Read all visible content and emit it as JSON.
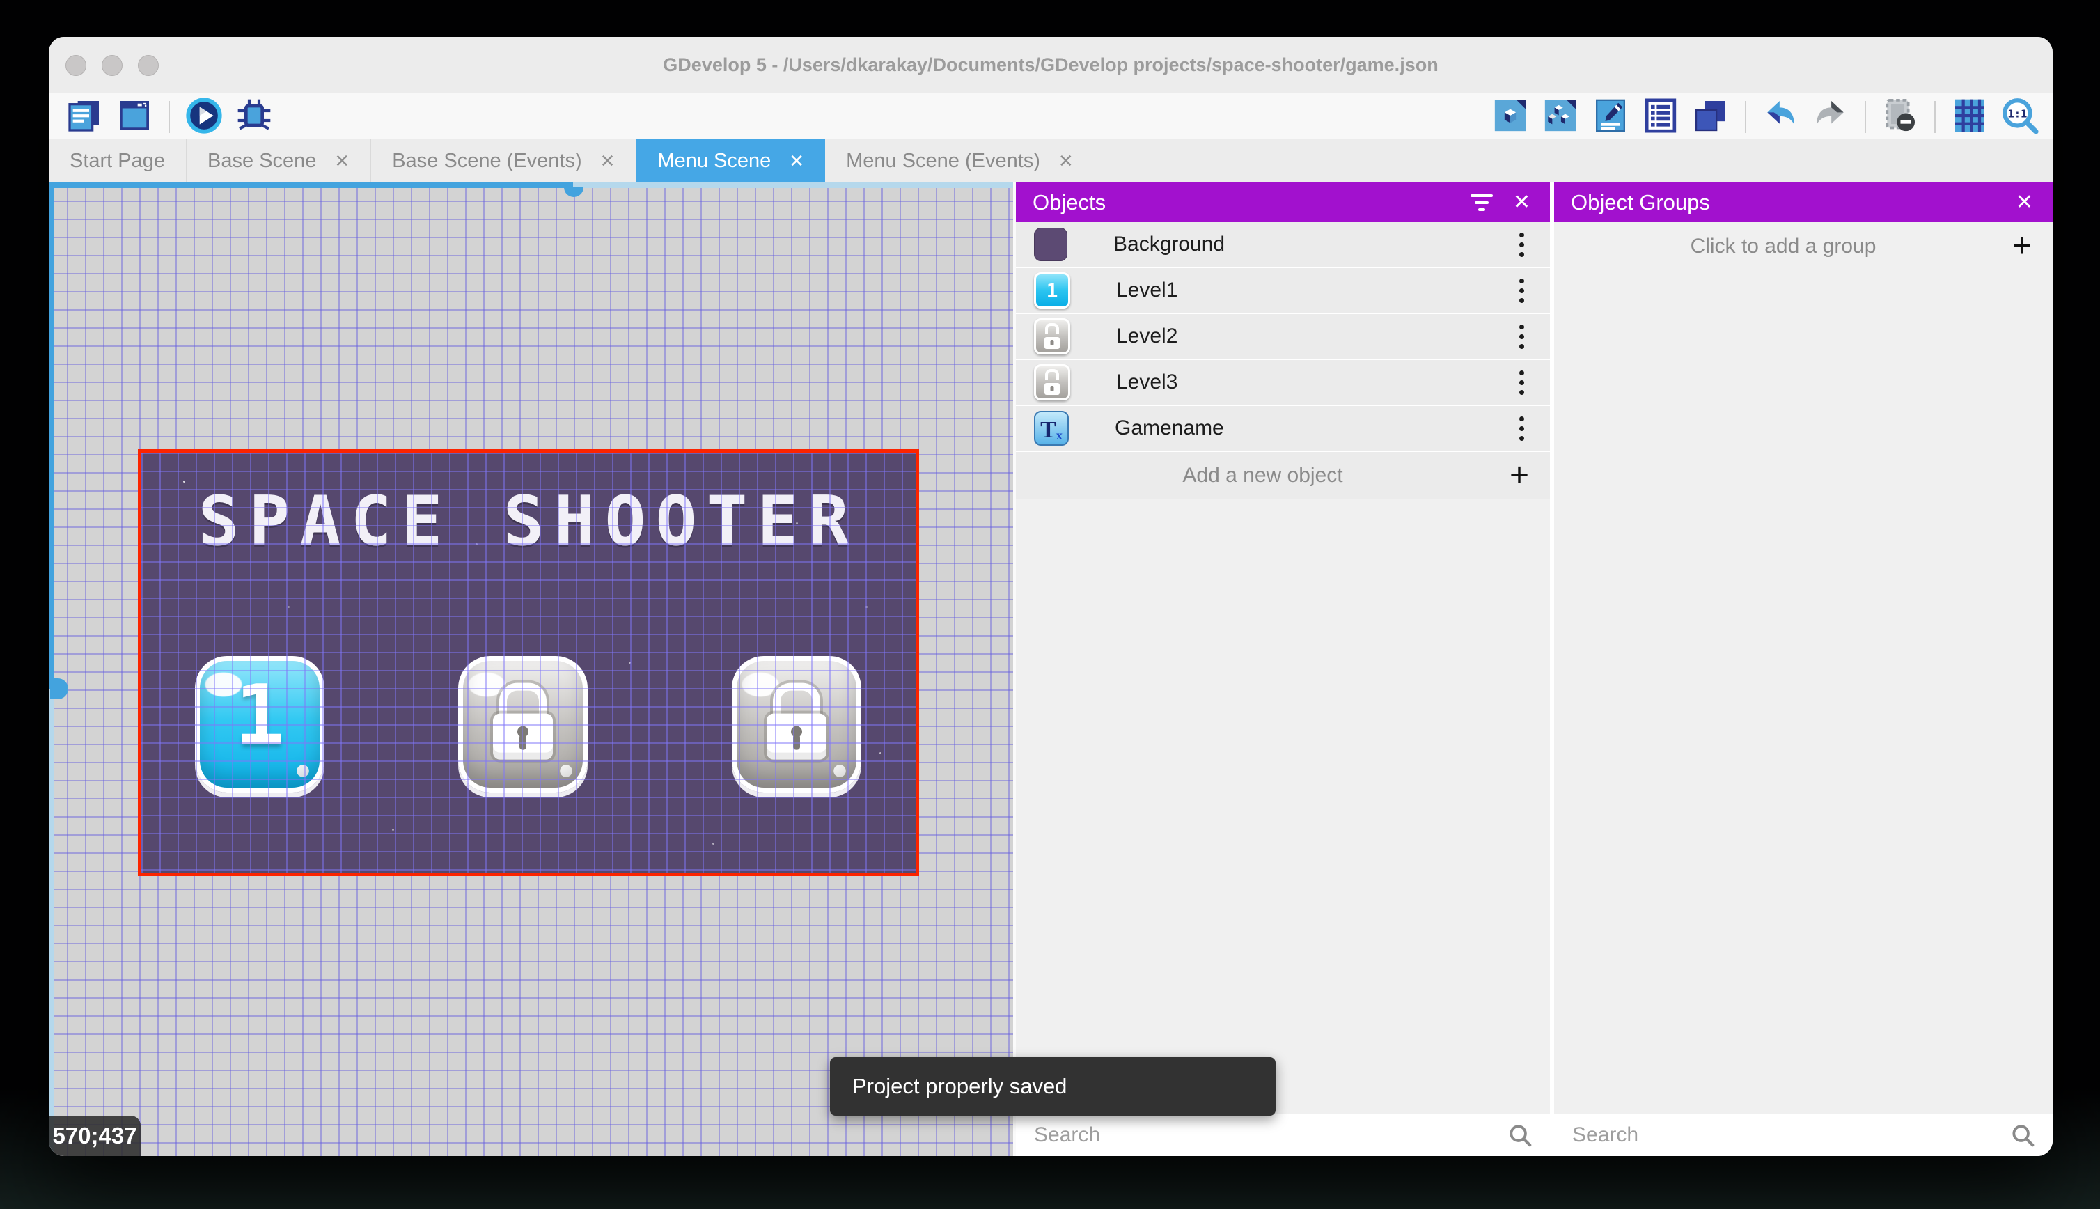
{
  "window": {
    "title": "GDevelop 5 - /Users/dkarakay/Documents/GDevelop projects/space-shooter/game.json"
  },
  "traffic_lights": [
    "close",
    "minimize",
    "zoom"
  ],
  "toolbar": {
    "left": [
      {
        "icon": "project-manager"
      },
      {
        "icon": "scene-window"
      },
      {
        "divider": true
      },
      {
        "icon": "play-preview"
      },
      {
        "icon": "debug"
      }
    ],
    "right": [
      {
        "icon": "objects-editor"
      },
      {
        "icon": "object-groups"
      },
      {
        "icon": "properties"
      },
      {
        "icon": "instances-list"
      },
      {
        "icon": "layers"
      },
      {
        "divider": true
      },
      {
        "icon": "undo"
      },
      {
        "icon": "redo"
      },
      {
        "divider": true
      },
      {
        "icon": "toggle-mask"
      },
      {
        "divider": true
      },
      {
        "icon": "toggle-grid"
      },
      {
        "icon": "zoom-original"
      }
    ]
  },
  "tabs": [
    {
      "label": "Start Page",
      "closable": false,
      "active": false
    },
    {
      "label": "Base Scene",
      "closable": true,
      "active": false
    },
    {
      "label": "Base Scene (Events)",
      "closable": true,
      "active": false
    },
    {
      "label": "Menu Scene",
      "closable": true,
      "active": true
    },
    {
      "label": "Menu Scene (Events)",
      "closable": true,
      "active": false
    }
  ],
  "canvas": {
    "coordinates": "570;437",
    "scene": {
      "title": "SPACE SHOOTER",
      "buttons": [
        {
          "kind": "level",
          "label": "1"
        },
        {
          "kind": "locked",
          "label": ""
        },
        {
          "kind": "locked",
          "label": ""
        }
      ]
    }
  },
  "objects_panel": {
    "title": "Objects",
    "items": [
      {
        "name": "Background",
        "icon": "background-swatch"
      },
      {
        "name": "Level1",
        "icon": "level1-button"
      },
      {
        "name": "Level2",
        "icon": "locked-button"
      },
      {
        "name": "Level3",
        "icon": "locked-button"
      },
      {
        "name": "Gamename",
        "icon": "text-object"
      }
    ],
    "add_label": "Add a new object",
    "search_placeholder": "Search"
  },
  "object_groups_panel": {
    "title": "Object Groups",
    "empty_label": "Click to add a group",
    "search_placeholder": "Search"
  },
  "toast": {
    "message": "Project properly saved"
  },
  "colors": {
    "panel_header": "#a211ce",
    "active_tab": "#45a7e6",
    "scene_background": "#56486e",
    "scene_frame": "#fb2400",
    "grid_line": "#655dde",
    "scrollbar": "#43a3de",
    "toast_background": "#323232"
  }
}
